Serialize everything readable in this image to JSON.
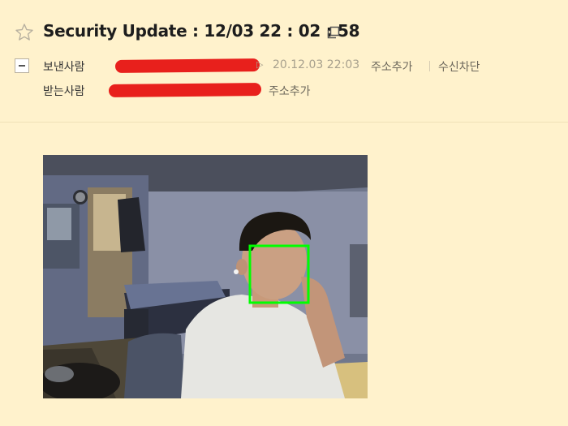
{
  "mail": {
    "subject": "Security Update : 12/03 22 : 02 : 58",
    "from_label": "보낸사람",
    "to_label": "받는사람",
    "date": "20.12.03 22:03",
    "add_address_label": "주소추가",
    "block_label": "수신차단"
  },
  "attachment": {
    "face_box_color": "#00ff00"
  }
}
